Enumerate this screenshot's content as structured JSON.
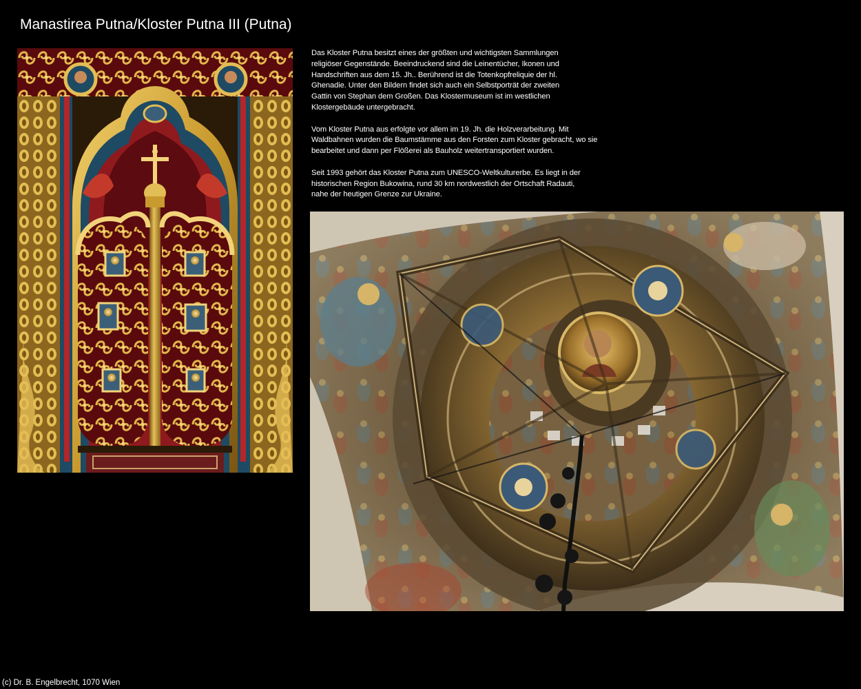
{
  "page": {
    "title": "Manastirea Putna/Kloster Putna III (Putna)",
    "background_color": "#000000",
    "text_color": "#ffffff"
  },
  "description": {
    "paragraphs": [
      {
        "lines": [
          "Das Kloster Putna besitzt eines der größten und wichtigsten Sammlungen",
          "religiöser Gegenstände. Beeindruckend sind die Leinentücher, Ikonen und",
          "Handschriften aus dem 15. Jh.. Berührend ist die Totenkopfreliquie der hl.",
          "Ghenadie. Unter den Bildern findet sich auch ein Selbstporträt der zweiten",
          "Gattin von Stephan dem Großen. Das Klostermuseum ist im westlichen",
          "Klostergebäude untergebracht."
        ]
      },
      {
        "lines": [
          "Vom Kloster Putna aus erfolgte vor allem im 19. Jh. die Holzverarbeitung. Mit",
          "Waldbahnen wurden die Baumstämme aus den Forsten zum Kloster gebracht, wo sie",
          "bearbeitet und dann per Flößerei als Bauholz weitertransportiert wurden."
        ]
      },
      {
        "lines": [
          "Seit 1993 gehört das Kloster Putna zum UNESCO-Weltkulturerbe. Es liegt in der",
          "historischen Region Bukowina, rund 30 km nordwestlich der Ortschaft Radauti,",
          "nahe der heutigen Grenze zur Ukraine."
        ]
      }
    ]
  },
  "photos": {
    "iconostasis": {
      "colors": {
        "gold": "#c99a2e",
        "red": "#7a0d12",
        "blue": "#1f4a63"
      }
    },
    "dome": {
      "colors": {
        "fresco": "#8a7455",
        "gold": "#b8923e",
        "shadow": "#2b2218"
      }
    }
  },
  "footer": {
    "copyright": "(c) Dr. B. Engelbrecht, 1070 Wien"
  }
}
